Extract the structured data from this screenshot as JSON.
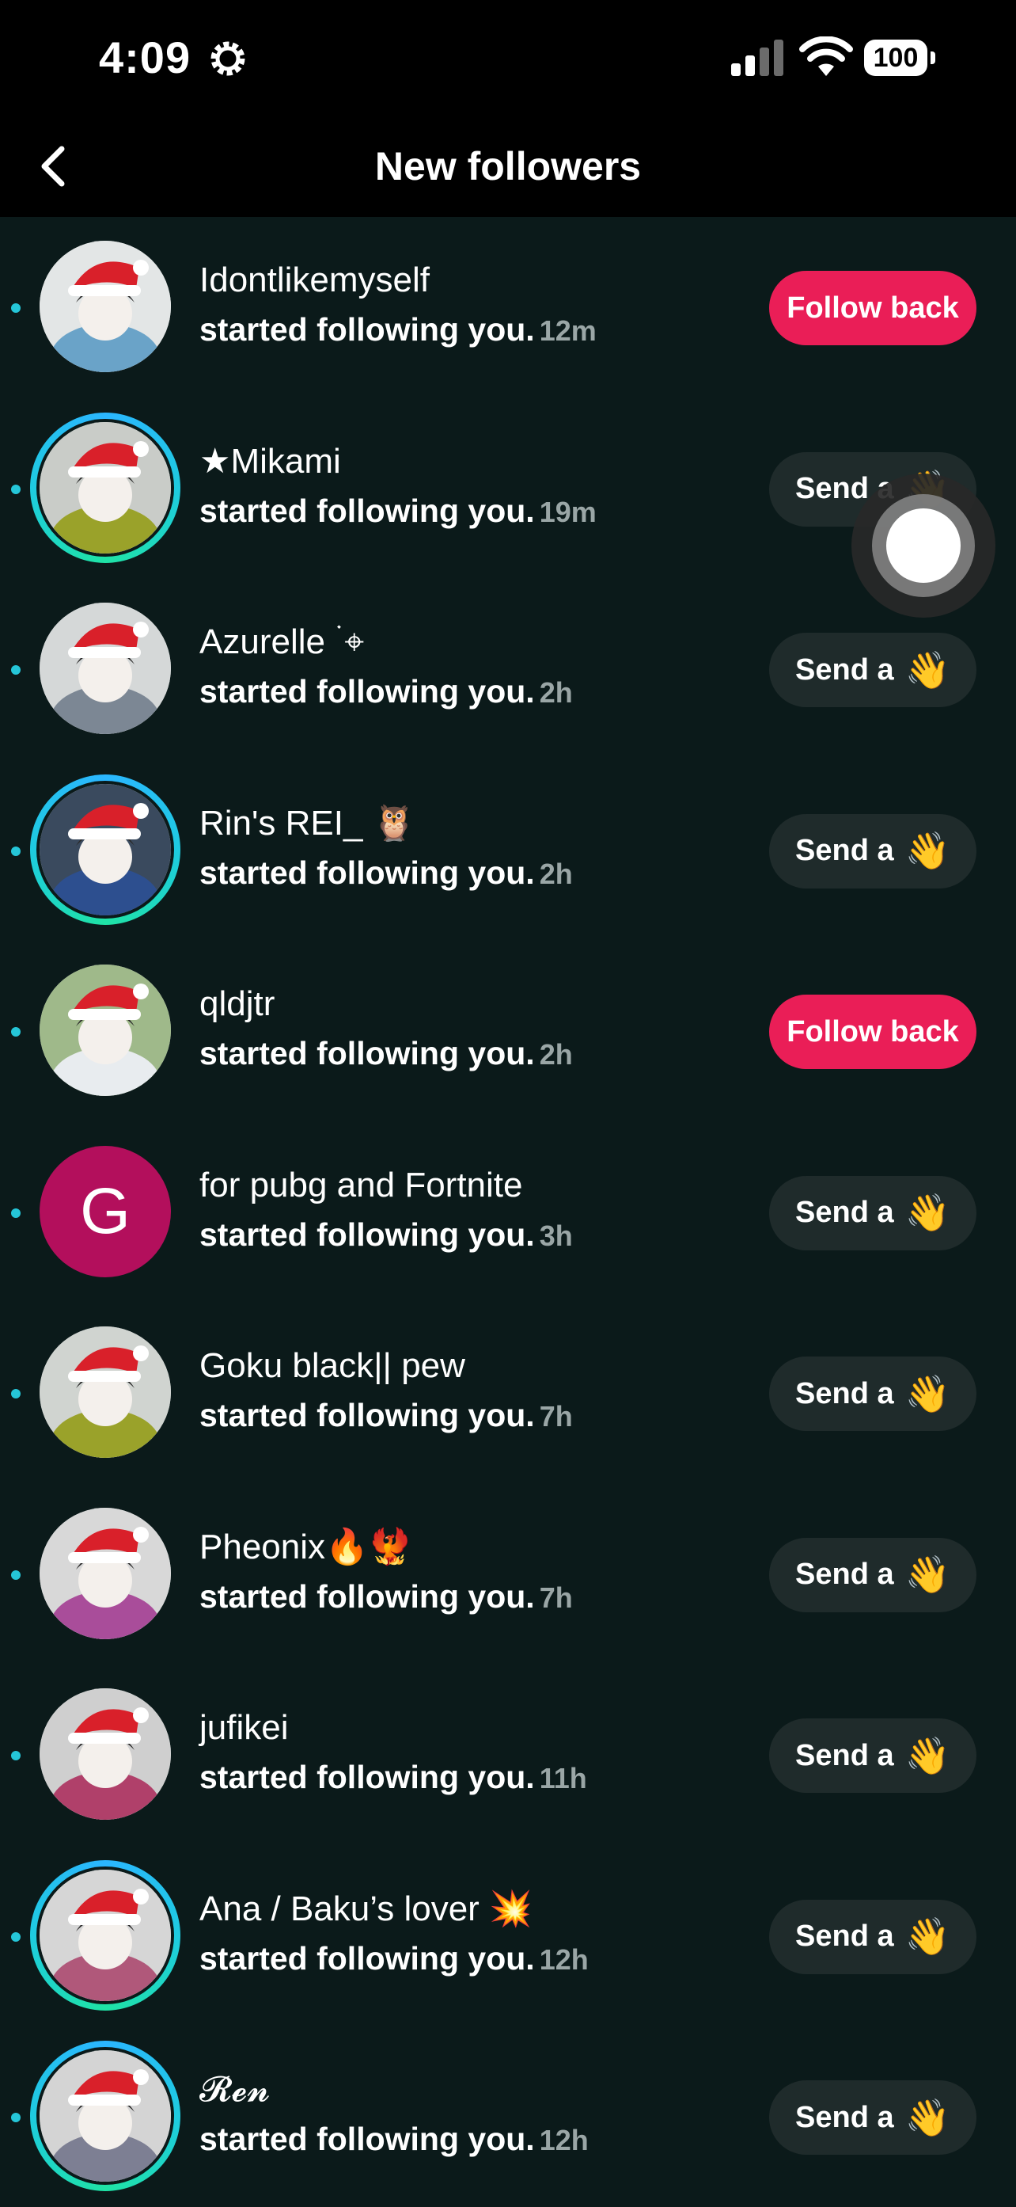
{
  "status_bar": {
    "time": "4:09",
    "battery": "100"
  },
  "header": {
    "title": "New followers"
  },
  "followers": [
    {
      "name": "Idontlikemyself",
      "text": "started following you.",
      "ago": "12m",
      "action": "Follow back",
      "type": "follow",
      "ring": false
    },
    {
      "name": "★Mikami",
      "text": "started following you.",
      "ago": "19m",
      "action": "Send a",
      "type": "wave",
      "ring": true
    },
    {
      "name": "Azurelle ࣪ ⌖",
      "text": "started following you.",
      "ago": "2h",
      "action": "Send a",
      "type": "wave",
      "ring": false
    },
    {
      "name": "Rin's REI_ 🦉",
      "text": "started following you.",
      "ago": "2h",
      "action": "Send a",
      "type": "wave",
      "ring": true
    },
    {
      "name": "qldjtr",
      "text": "started following you.",
      "ago": "2h",
      "action": "Follow back",
      "type": "follow",
      "ring": false
    },
    {
      "name": "for pubg and Fortnite",
      "text": "started following you.",
      "ago": "3h",
      "action": "Send a",
      "type": "wave",
      "ring": false,
      "letter": "G"
    },
    {
      "name": "Goku black|| pew",
      "text": "started following you.",
      "ago": "7h",
      "action": "Send a",
      "type": "wave",
      "ring": false
    },
    {
      "name": "Pheonix🔥🐦‍🔥",
      "text": "started following you.",
      "ago": "7h",
      "action": "Send a",
      "type": "wave",
      "ring": false
    },
    {
      "name": "jufikei",
      "text": "started following you.",
      "ago": "11h",
      "action": "Send a",
      "type": "wave",
      "ring": false
    },
    {
      "name": "Ana / Baku’s lover 💥",
      "text": "started following you.",
      "ago": "12h",
      "action": "Send a",
      "type": "wave",
      "ring": true
    },
    {
      "name": "𝓡𝓮𝓷",
      "text": "started following you.",
      "ago": "12h",
      "action": "Send a",
      "type": "wave",
      "ring": true
    }
  ],
  "wave_emoji": "👋",
  "colors": {
    "follow_back": "#ea1e57",
    "send_button": "#1f2b2b",
    "unread_dot": "#25c6d8",
    "background": "#0b1a1a"
  }
}
